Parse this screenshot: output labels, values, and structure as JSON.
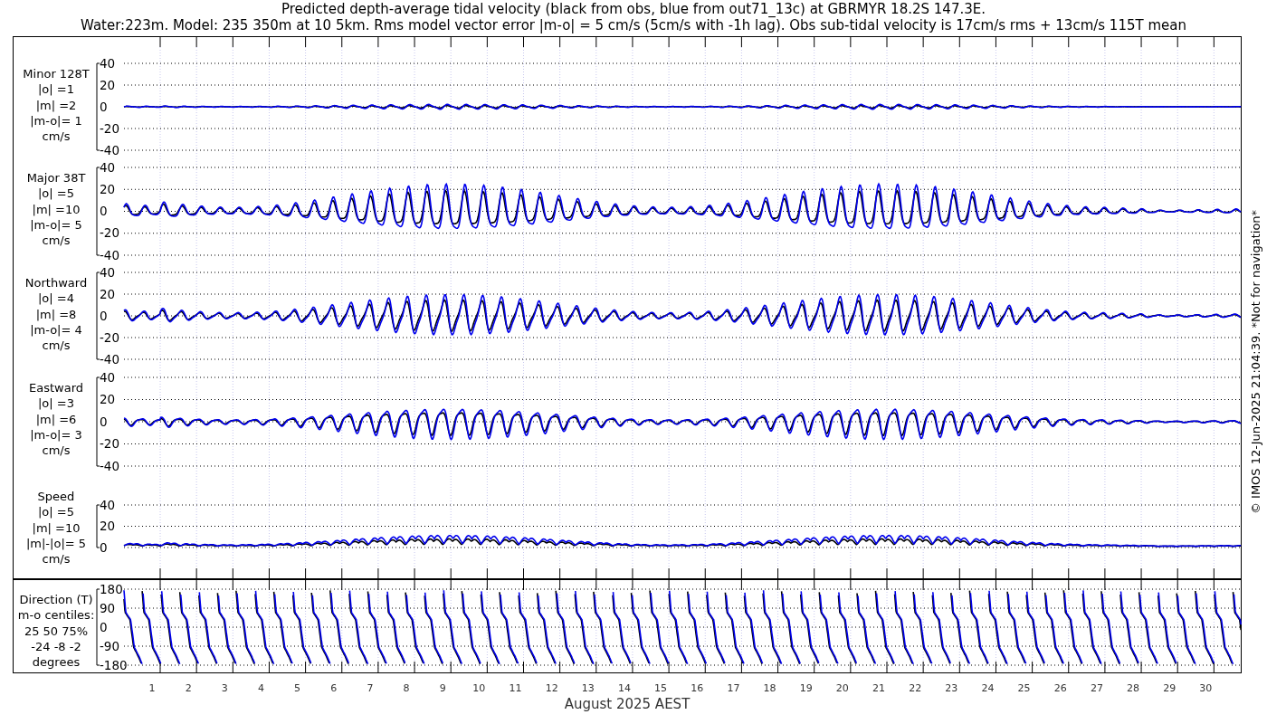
{
  "title_lines": [
    "Predicted depth-average tidal velocity (black from obs, blue from out71_13c) at GBRMYR 18.2S 147.3E.",
    "Water:223m. Model: 235 350m at 10 5km. Rms model vector error |m-o| = 5 cm/s (5cm/s with -1h lag). Obs sub-tidal velocity is 17cm/s rms + 13cm/s 115T mean"
  ],
  "panels": [
    {
      "kind": "velocity",
      "label_lines": [
        "Minor 128T",
        "|o| =1",
        "|m| =2",
        "|m-o|= 1",
        "cm/s"
      ],
      "yticks": [
        "40",
        "20",
        "0",
        "-20",
        "-40"
      ]
    },
    {
      "kind": "velocity",
      "label_lines": [
        "Major 38T",
        "|o| =5",
        "|m| =10",
        "|m-o|= 5",
        "cm/s"
      ],
      "yticks": [
        "40",
        "20",
        "0",
        "-20",
        "-40"
      ]
    },
    {
      "kind": "velocity",
      "label_lines": [
        "Northward",
        "|o| =4",
        "|m| =8",
        "|m-o|= 4",
        "cm/s"
      ],
      "yticks": [
        "40",
        "20",
        "0",
        "-20",
        "-40"
      ]
    },
    {
      "kind": "velocity",
      "label_lines": [
        "Eastward",
        "|o| =3",
        "|m| =6",
        "|m-o|= 3",
        "cm/s"
      ],
      "yticks": [
        "40",
        "20",
        "0",
        "-20",
        "-40"
      ]
    },
    {
      "kind": "speed",
      "label_lines": [
        "Speed",
        "|o| =5",
        "|m| =10",
        "|m|-|o|= 5",
        "cm/s"
      ],
      "yticks": [
        "40",
        "20",
        "0"
      ]
    },
    {
      "kind": "direction",
      "label_lines": [
        "Direction (T)",
        "m-o centiles:",
        "25  50  75%",
        "-24  -8  -2",
        "degrees"
      ],
      "yticks": [
        "180",
        "90",
        "0",
        "-90",
        "-180"
      ]
    }
  ],
  "days": [
    "1",
    "2",
    "3",
    "4",
    "5",
    "6",
    "7",
    "8",
    "9",
    "10",
    "11",
    "12",
    "13",
    "14",
    "15",
    "16",
    "17",
    "18",
    "19",
    "20",
    "21",
    "22",
    "23",
    "24",
    "25",
    "26",
    "27",
    "28",
    "29",
    "30"
  ],
  "xlabel": "August 2025 AEST",
  "credit": "© IMOS 12-Jun-2025 21:04:39. *Not for navigation*"
}
